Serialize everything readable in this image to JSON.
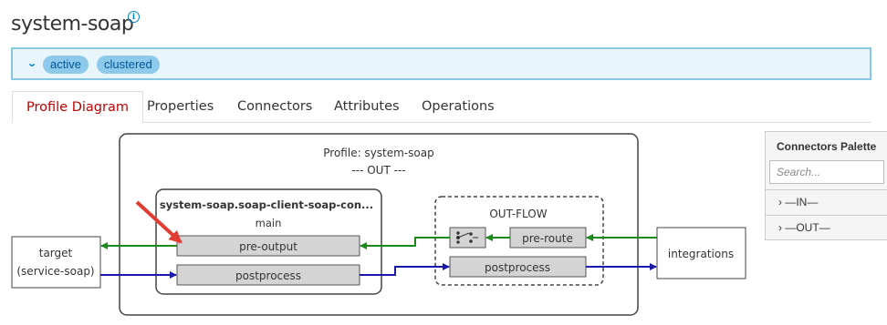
{
  "header": {
    "title": "system-soap",
    "info_icon": "i"
  },
  "status": {
    "chevron": "⌄",
    "badges": [
      "active",
      "clustered"
    ]
  },
  "tabs": [
    {
      "label": "Profile Diagram",
      "active": true
    },
    {
      "label": "Properties",
      "active": false
    },
    {
      "label": "Connectors",
      "active": false
    },
    {
      "label": "Attributes",
      "active": false
    },
    {
      "label": "Operations",
      "active": false
    }
  ],
  "diagram": {
    "profile_title": "Profile: system-soap",
    "profile_subtitle": "--- OUT ---",
    "target_line1": "target",
    "target_line2": "(service-soap)",
    "connector_title": "system-soap.soap-client-soap-con...",
    "connector_subtitle": "main",
    "pre_output": "pre-output",
    "postprocess_left": "postprocess",
    "outflow_title": "OUT-FLOW",
    "pre_route": "pre-route",
    "postprocess_right": "postprocess",
    "integrations": "integrations"
  },
  "palette": {
    "title": "Connectors Palette",
    "search_placeholder": "Search...",
    "in_label": "› —IN—",
    "out_label": "› —OUT—"
  },
  "colors": {
    "green_flow": "#1b8a1b",
    "blue_flow": "#1a1aaa",
    "arrow_annotation": "#e03c31",
    "active_tab": "#c00000",
    "badge_bg": "#8cc9ea"
  }
}
